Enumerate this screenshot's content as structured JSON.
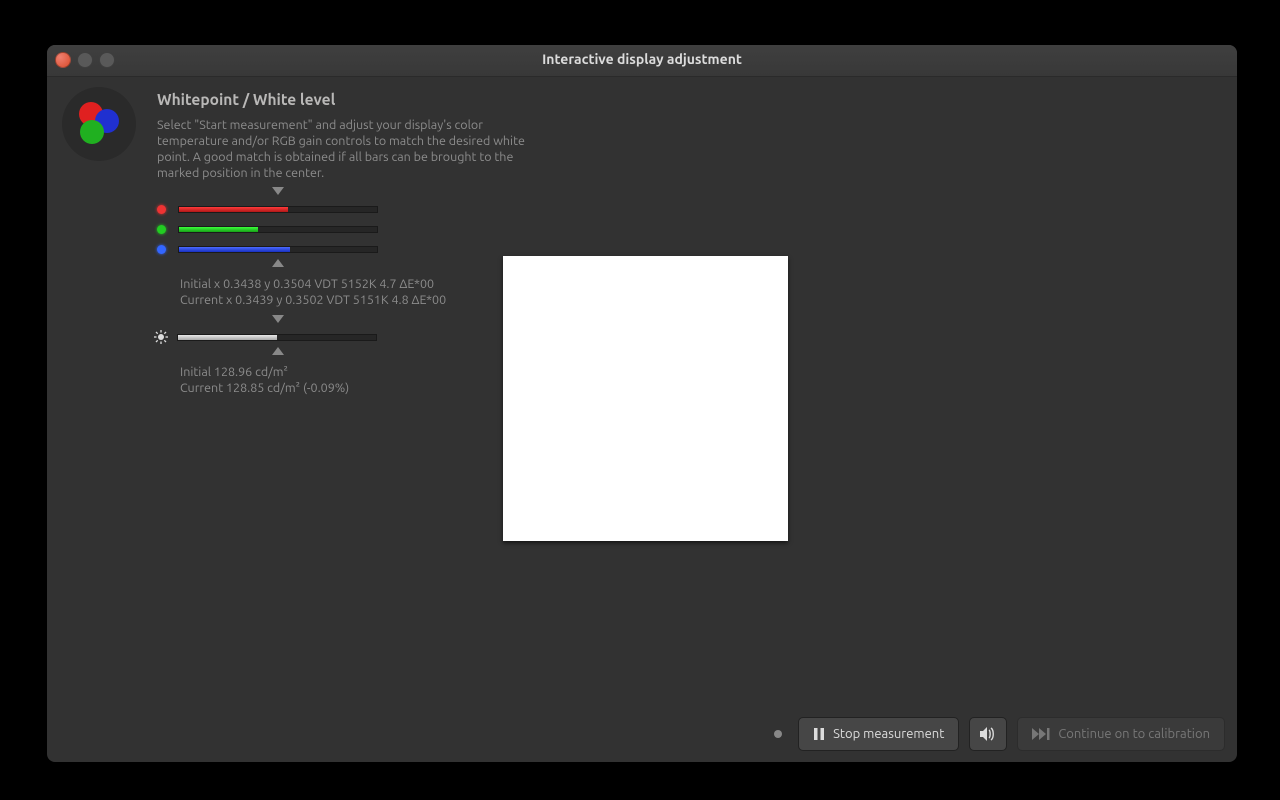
{
  "window": {
    "title": "Interactive display adjustment"
  },
  "section": {
    "heading": "Whitepoint / White level",
    "description": "Select \"Start measurement\" and adjust your display's color temperature and/or RGB gain controls to match the desired white point. A good match is obtained if all bars can be brought to the marked position in the center."
  },
  "bars": {
    "red_pct": 55,
    "green_pct": 40,
    "blue_pct": 56,
    "white_pct": 50,
    "whitepoint_initial": "Initial x 0.3438 y 0.3504 VDT 5152K 4.7 ΔE*00",
    "whitepoint_current": "Current x 0.3439 y 0.3502 VDT 5151K 4.8 ΔE*00",
    "luminance_initial": "Initial 128.96 cd/m²",
    "luminance_current": "Current 128.85 cd/m² (-0.09%)"
  },
  "footer": {
    "stop_label": "Stop measurement",
    "continue_label": "Continue on to calibration"
  }
}
